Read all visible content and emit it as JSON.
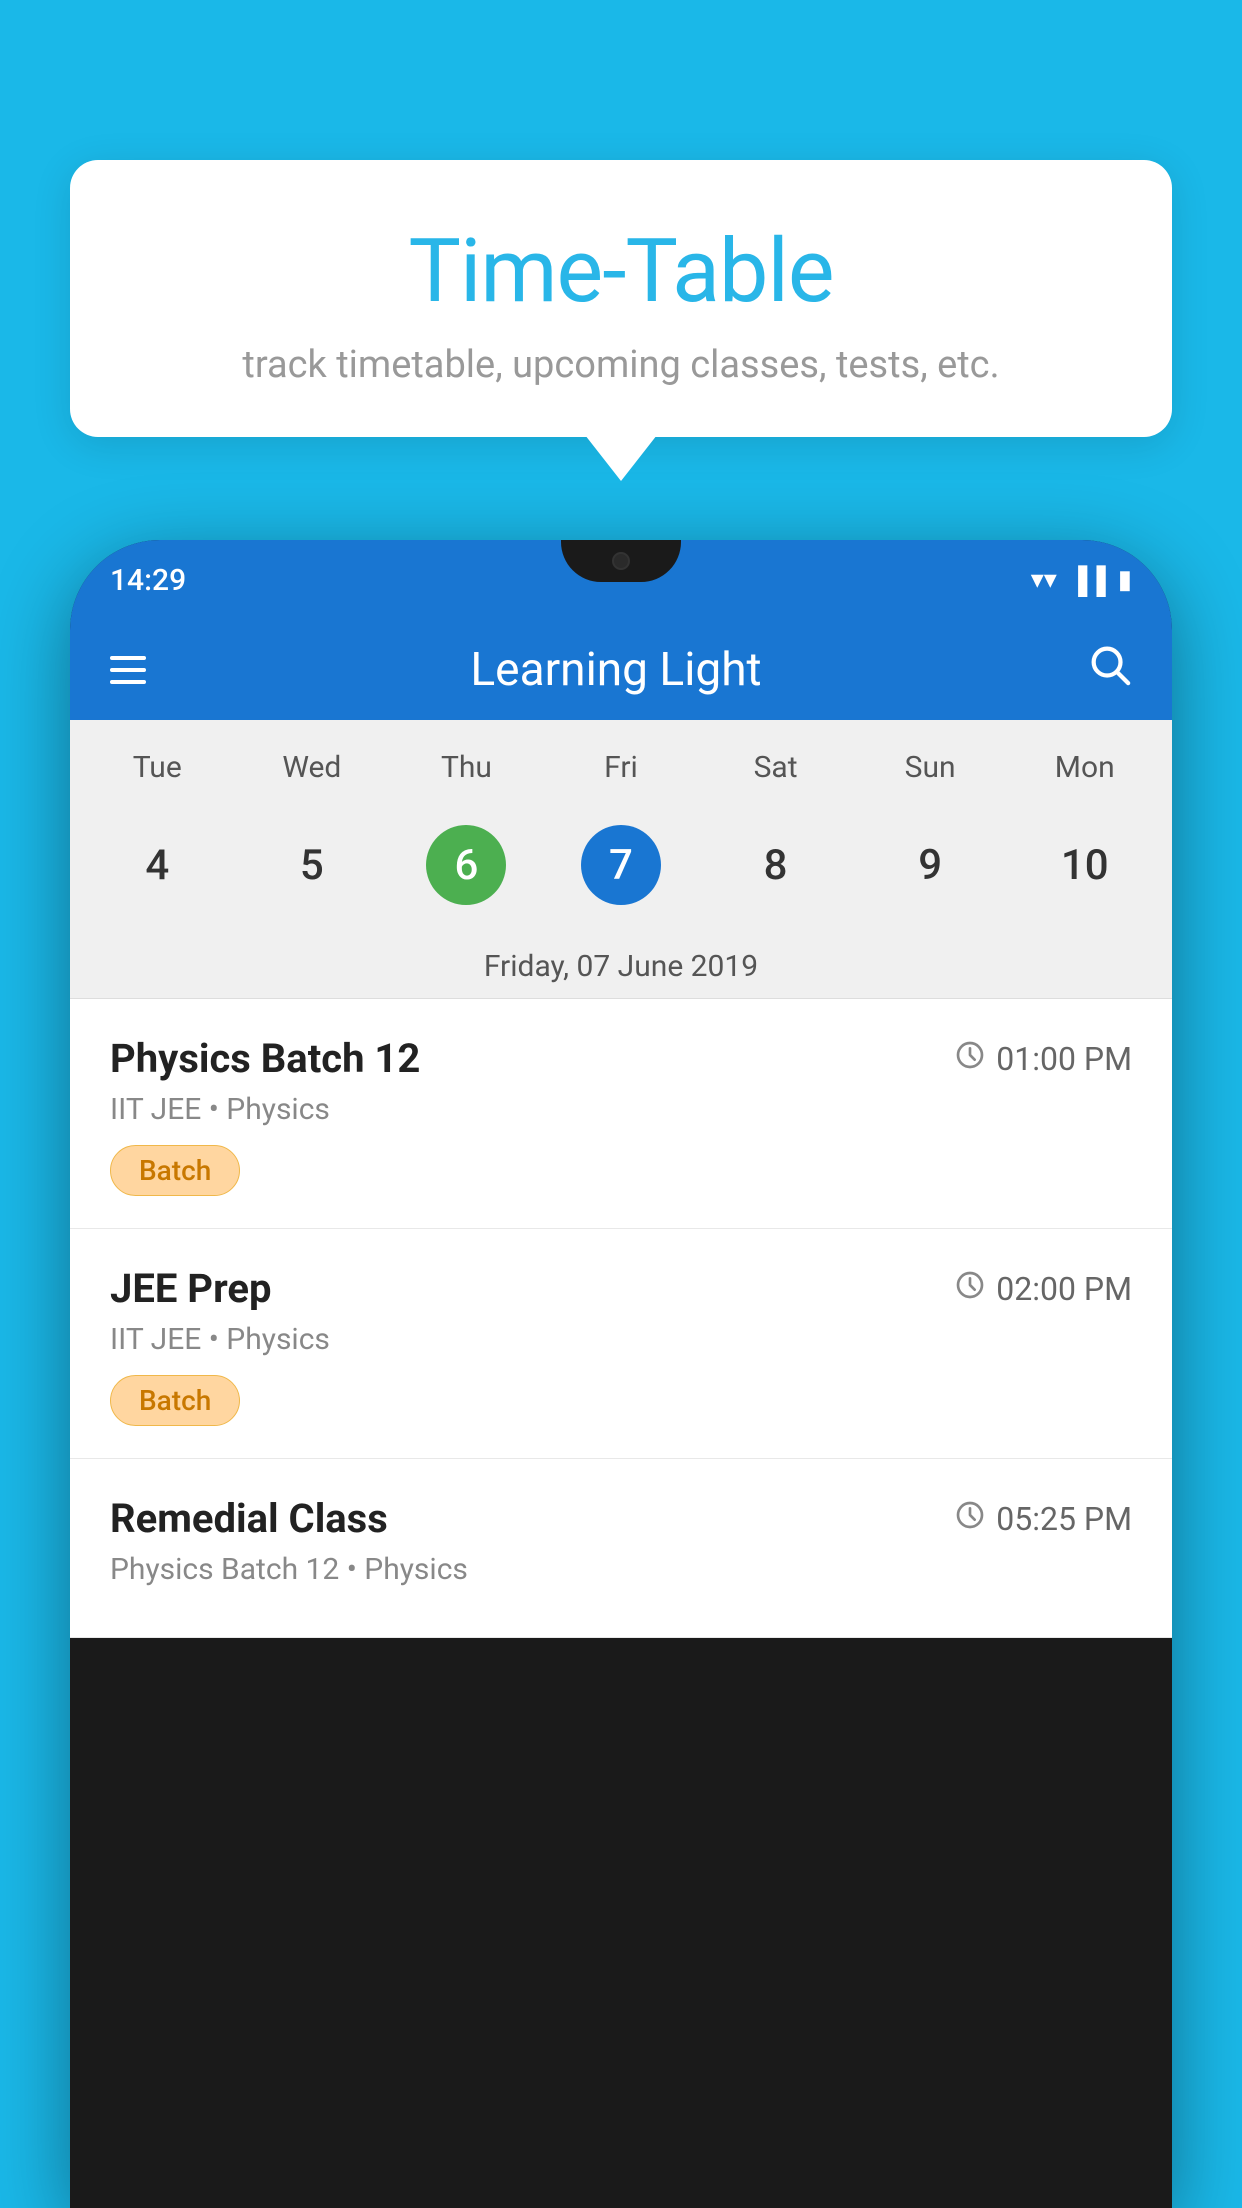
{
  "background": {
    "color": "#1ab8e8"
  },
  "tooltip": {
    "title": "Time-Table",
    "subtitle": "track timetable, upcoming classes, tests, etc."
  },
  "phone": {
    "status_bar": {
      "time": "14:29"
    },
    "app_header": {
      "title": "Learning Light"
    },
    "calendar": {
      "day_labels": [
        "Tue",
        "Wed",
        "Thu",
        "Fri",
        "Sat",
        "Sun",
        "Mon"
      ],
      "dates": [
        {
          "num": "4",
          "state": "normal"
        },
        {
          "num": "5",
          "state": "normal"
        },
        {
          "num": "6",
          "state": "today"
        },
        {
          "num": "7",
          "state": "selected"
        },
        {
          "num": "8",
          "state": "normal"
        },
        {
          "num": "9",
          "state": "normal"
        },
        {
          "num": "10",
          "state": "normal"
        }
      ],
      "selected_date_label": "Friday, 07 June 2019"
    },
    "schedule": {
      "items": [
        {
          "title": "Physics Batch 12",
          "time": "01:00 PM",
          "meta": "IIT JEE • Physics",
          "badge": "Batch"
        },
        {
          "title": "JEE Prep",
          "time": "02:00 PM",
          "meta": "IIT JEE • Physics",
          "badge": "Batch"
        },
        {
          "title": "Remedial Class",
          "time": "05:25 PM",
          "meta": "Physics Batch 12 • Physics",
          "badge": ""
        }
      ]
    }
  },
  "icons": {
    "hamburger": "☰",
    "search": "🔍",
    "clock": "🕐",
    "wifi": "▼",
    "signal": "▲",
    "battery": "▌"
  }
}
